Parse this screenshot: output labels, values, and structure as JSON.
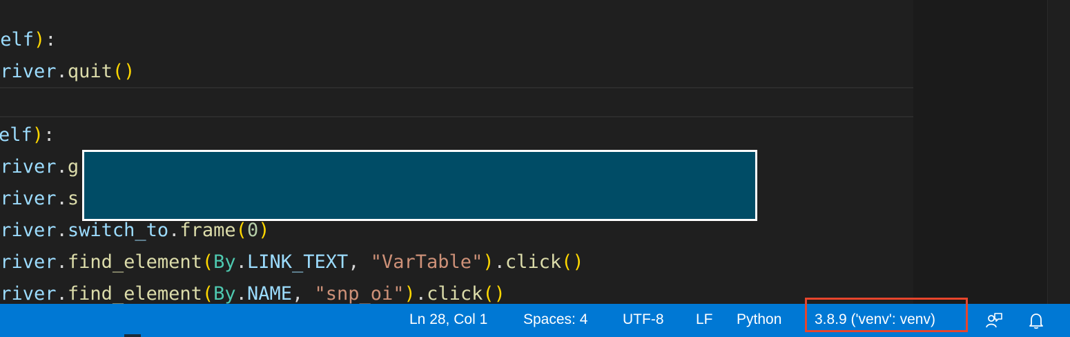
{
  "code": {
    "line1": {
      "a": "self",
      "b": ")",
      "c": ":"
    },
    "line2": {
      "a": "driver",
      "b": ".",
      "c": "quit",
      "d": "()"
    },
    "line3": {
      "a": "elf",
      "b": ")",
      "c": ":"
    },
    "line4": {
      "a": "driver",
      "b": ".",
      "c": "g"
    },
    "line5": {
      "a": "driver",
      "b": ".",
      "c": "s"
    },
    "line6": {
      "a": "driver",
      "b": ".",
      "c": "switch_to",
      "d": ".",
      "e": "frame",
      "f": "(",
      "g": "0",
      "h": ")"
    },
    "line7": {
      "a": "driver",
      "b": ".",
      "c": "find_element",
      "d": "(",
      "e": "By",
      "f": ".",
      "g": "LINK_TEXT",
      "h": ", ",
      "i": "\"VarTable\"",
      "j": ")",
      "k": ".",
      "l": "click",
      "m": "()"
    },
    "line8": {
      "a": "driver",
      "b": ".",
      "c": "find_element",
      "d": "(",
      "e": "By",
      "f": ".",
      "g": "NAME",
      "h": ", ",
      "i": "\"snp_oi\"",
      "j": ")",
      "k": ".",
      "l": "click",
      "m": "()"
    }
  },
  "statusbar": {
    "cursor": "Ln 28, Col 1",
    "spaces": "Spaces: 4",
    "encoding": "UTF-8",
    "eol": "LF",
    "language": "Python",
    "interpreter": "3.8.9 ('venv': venv)"
  },
  "icons": {
    "feedback": "feedback-icon",
    "notifications": "bell-icon"
  },
  "colors": {
    "statusbar": "#0078d4",
    "highlight": "#e8452c",
    "redaction": "#004c66"
  }
}
